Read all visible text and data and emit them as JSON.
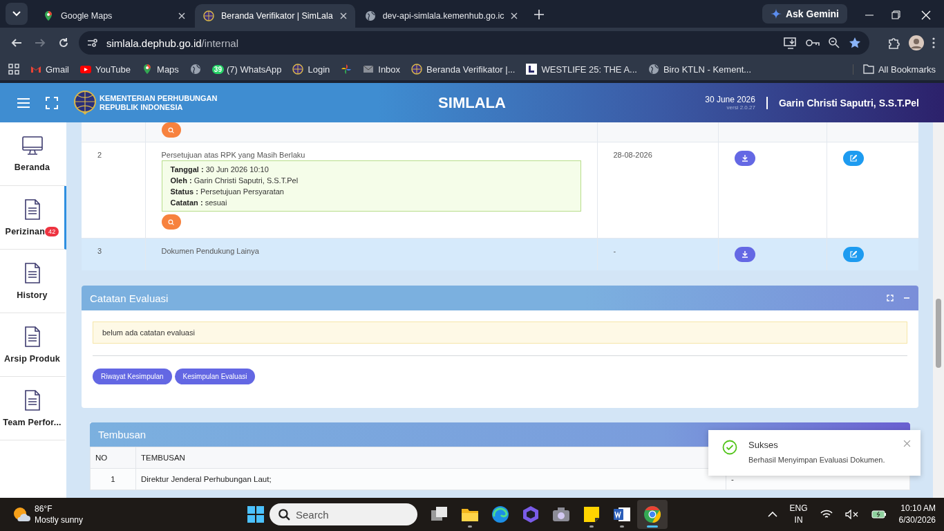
{
  "browser": {
    "tabs": [
      {
        "title": "Google Maps",
        "selected": false
      },
      {
        "title": "Beranda Verifikator | SimLala",
        "selected": true
      },
      {
        "title": "dev-api-simlala.kemenhub.go.ic",
        "selected": false
      }
    ],
    "ask_gemini": "Ask Gemini",
    "address_host": "simlala.dephub.go.id",
    "address_path": "/internal",
    "bookmarks": [
      {
        "kind": "link",
        "label": "Gmail"
      },
      {
        "kind": "link",
        "label": "YouTube"
      },
      {
        "kind": "link",
        "label": "Maps"
      },
      {
        "kind": "icon"
      },
      {
        "kind": "link",
        "label": "(7) WhatsApp",
        "badge": "39"
      },
      {
        "kind": "link",
        "label": "Login"
      },
      {
        "kind": "icon"
      },
      {
        "kind": "link",
        "label": "Inbox"
      },
      {
        "kind": "link",
        "label": "Beranda Verifikator |..."
      },
      {
        "kind": "link",
        "label": "WESTLIFE 25: THE A..."
      },
      {
        "kind": "link",
        "label": "Biro KTLN - Kement..."
      }
    ],
    "all_bookmarks": "All Bookmarks"
  },
  "header": {
    "org_line1": "KEMENTERIAN PERHUBUNGAN",
    "org_line2": "REPUBLIK INDONESIA",
    "title": "SIMLALA",
    "date": "30 June 2026",
    "version": "versi 2.0.27",
    "user": "Garin Christi Saputri, S.S.T.Pel"
  },
  "sidebar": {
    "items": [
      {
        "label": "Beranda",
        "selected": false
      },
      {
        "label": "Perizinan",
        "selected": true,
        "badge": "42"
      },
      {
        "label": "History",
        "selected": false
      },
      {
        "label": "Arsip Produk",
        "selected": false
      },
      {
        "label": "Team Perfor...",
        "selected": false
      }
    ]
  },
  "documents": {
    "rows": [
      {
        "search": true,
        "download": false,
        "edit": false,
        "hovered": false
      },
      {
        "no": "2",
        "name": "Persetujuan atas RPK yang Masih Berlaku",
        "details": [
          {
            "label": "Tanggal :",
            "value": "30 Jun 2026 10:10"
          },
          {
            "label": "Oleh :",
            "value": "Garin Christi Saputri, S.S.T.Pel"
          },
          {
            "label": "Status :",
            "value": "Persetujuan Persyaratan"
          },
          {
            "label": "Catatan :",
            "value": "sesuai"
          }
        ],
        "date": "28-08-2026",
        "search": true,
        "download": true,
        "edit": true,
        "hovered": false
      },
      {
        "no": "3",
        "name": "Dokumen Pendukung Lainya",
        "date": "-",
        "search": false,
        "download": true,
        "edit": true,
        "hovered": true
      }
    ]
  },
  "evaluation": {
    "title": "Catatan Evaluasi",
    "note": "belum ada catatan evaluasi",
    "buttons": [
      "Riwayat Kesimpulan",
      "Kesimpulan Evaluasi"
    ]
  },
  "tembusan": {
    "title": "Tembusan",
    "columns": [
      "NO",
      "TEMBUSAN"
    ],
    "rows": [
      {
        "no": "1",
        "text": "Direktur Jenderal Perhubungan Laut;",
        "column_3": "-"
      }
    ]
  },
  "toast": {
    "title": "Sukses",
    "message": "Berhasil Menyimpan Evaluasi Dokumen."
  },
  "taskbar": {
    "temperature": "86°F",
    "weather": "Mostly sunny",
    "search_placeholder": "Search",
    "apps": [
      {
        "open": false,
        "active": false
      },
      {
        "open": true,
        "active": false
      },
      {
        "open": false,
        "active": false
      },
      {
        "open": false,
        "active": false
      },
      {
        "open": false,
        "active": false
      },
      {
        "open": true,
        "active": false
      },
      {
        "open": true,
        "active": false
      },
      {
        "open": true,
        "active": true
      }
    ],
    "lang1": "ENG",
    "lang2": "IN",
    "time": "10:10 AM",
    "date": "6/30/2026"
  }
}
